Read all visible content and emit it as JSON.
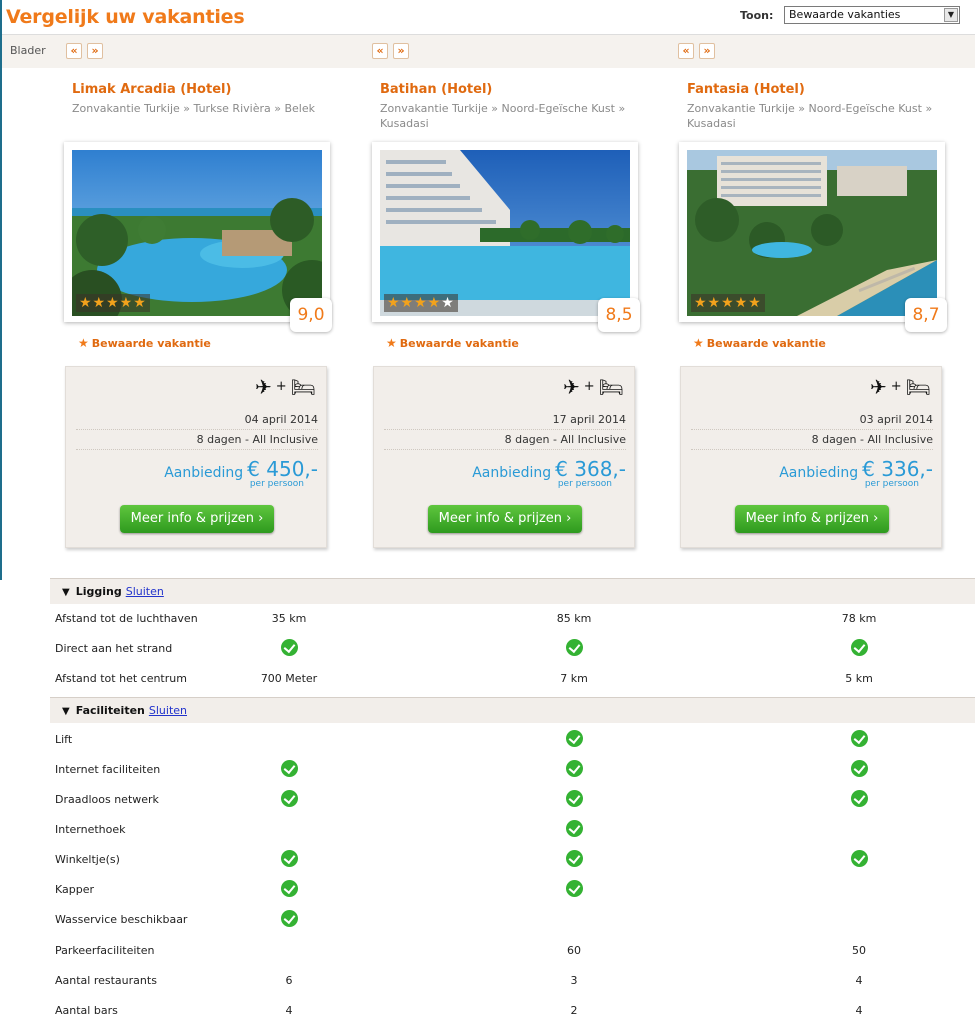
{
  "header": {
    "title": "Vergelijk uw vakanties",
    "toon_label": "Toon:",
    "toon_value": "Bewaarde vakanties"
  },
  "nav": {
    "blader_label": "Blader",
    "prev": "«",
    "next": "»"
  },
  "hotels": [
    {
      "name": "Limak Arcadia (Hotel)",
      "crumb": "Zonvakantie Turkije » Turkse Rivièra » Belek",
      "stars": "★★★★★",
      "stars_off": "",
      "rating": "9,0",
      "saved_label": "Bewaarde vakantie",
      "date": "04 april 2014",
      "duration": "8 dagen - All Inclusive",
      "offer_label": "Aanbieding",
      "price": "€ 450,-",
      "per_person": "per persoon",
      "cta": "Meer info & prijzen ›"
    },
    {
      "name": "Batihan (Hotel)",
      "crumb": "Zonvakantie Turkije » Noord-Egeïsche Kust » Kusadasi",
      "stars": "★★★★",
      "stars_off": "★",
      "rating": "8,5",
      "saved_label": "Bewaarde vakantie",
      "date": "17 april 2014",
      "duration": "8 dagen - All Inclusive",
      "offer_label": "Aanbieding",
      "price": "€ 368,-",
      "per_person": "per persoon",
      "cta": "Meer info & prijzen ›"
    },
    {
      "name": "Fantasia (Hotel)",
      "crumb": "Zonvakantie Turkije » Noord-Egeïsche Kust » Kusadasi",
      "stars": "★★★★★",
      "stars_off": "",
      "rating": "8,7",
      "saved_label": "Bewaarde vakantie",
      "date": "03 april 2014",
      "duration": "8 dagen - All Inclusive",
      "offer_label": "Aanbieding",
      "price": "€ 336,-",
      "per_person": "per persoon",
      "cta": "Meer info & prijzen ›"
    }
  ],
  "icons": {
    "flight": "plane-icon",
    "plus": "+",
    "bed": "bed-icon",
    "check": "check-icon"
  },
  "sections": [
    {
      "title": "Ligging",
      "close_label": "Sluiten",
      "rows": [
        {
          "label": "Afstand tot de luchthaven",
          "values": [
            "35 km",
            "85 km",
            "78 km"
          ]
        },
        {
          "label": "Direct aan het strand",
          "values": [
            "✓",
            "✓",
            "✓"
          ]
        },
        {
          "label": "Afstand tot het centrum",
          "values": [
            "700 Meter",
            "7 km",
            "5 km"
          ]
        }
      ]
    },
    {
      "title": "Faciliteiten",
      "close_label": "Sluiten",
      "rows": [
        {
          "label": "Lift",
          "values": [
            "",
            "✓",
            "✓"
          ]
        },
        {
          "label": "Internet faciliteiten",
          "values": [
            "✓",
            "✓",
            "✓"
          ]
        },
        {
          "label": "Draadloos netwerk",
          "values": [
            "✓",
            "✓",
            "✓"
          ]
        },
        {
          "label": "Internethoek",
          "values": [
            "",
            "✓",
            ""
          ]
        },
        {
          "label": "Winkeltje(s)",
          "values": [
            "✓",
            "✓",
            "✓"
          ]
        },
        {
          "label": "Kapper",
          "values": [
            "✓",
            "✓",
            ""
          ]
        },
        {
          "label": "Wasservice beschikbaar",
          "values": [
            "✓",
            "",
            ""
          ]
        },
        {
          "label": "Parkeerfaciliteiten",
          "values": [
            "",
            "60",
            "50"
          ]
        },
        {
          "label": "Aantal restaurants",
          "values": [
            "6",
            "3",
            "4"
          ]
        },
        {
          "label": "Aantal bars",
          "values": [
            "4",
            "2",
            "4"
          ]
        }
      ]
    }
  ],
  "colors": {
    "accent": "#f07a1a",
    "price": "#2a9ad6",
    "cta": "#3aa828",
    "check": "#34b233"
  }
}
